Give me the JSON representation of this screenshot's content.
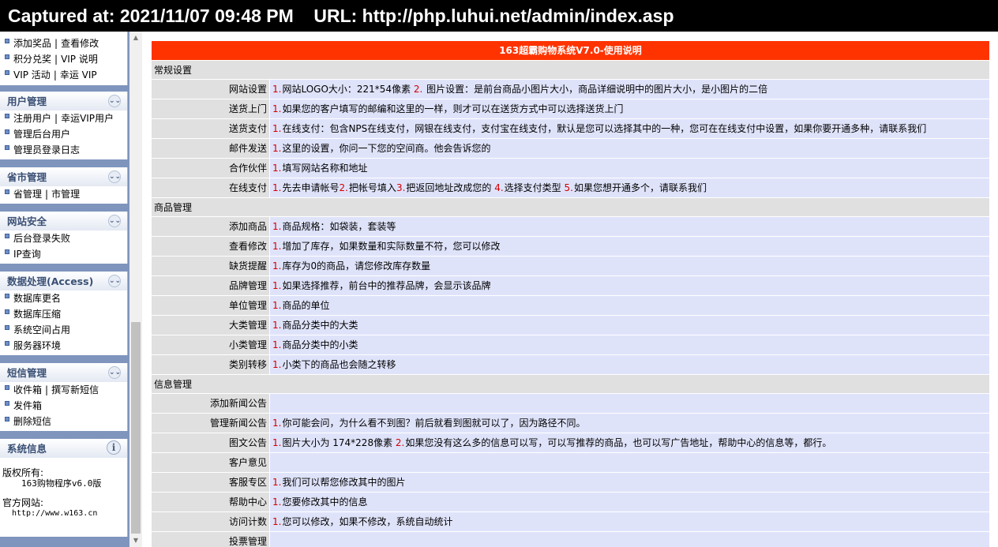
{
  "capture_bar": {
    "text": "Captured at: 2021/11/07 09:48 PM    URL: http://php.luhui.net/admin/index.asp"
  },
  "sidebar": {
    "top_partial": {
      "lines": [
        [
          "添加奖品",
          "查看修改"
        ],
        [
          "积分兑奖",
          "VIP 说明"
        ],
        [
          "VIP 活动",
          "幸运 VIP"
        ]
      ]
    },
    "user_mgmt": {
      "title": "用户管理",
      "lines": [
        [
          "注册用户",
          "幸运VIP用户"
        ],
        [
          "管理后台用户"
        ],
        [
          "管理员登录日志"
        ]
      ]
    },
    "region_mgmt": {
      "title": "省市管理",
      "lines": [
        [
          "省管理",
          "市管理"
        ]
      ]
    },
    "site_security": {
      "title": "网站安全",
      "lines": [
        [
          "后台登录失败"
        ],
        [
          "IP查询"
        ]
      ]
    },
    "data_proc": {
      "title": "数据处理(Access)",
      "lines": [
        [
          "数据库更名"
        ],
        [
          "数据库压缩"
        ],
        [
          "系统空间占用"
        ],
        [
          "服务器环境"
        ]
      ]
    },
    "sms_mgmt": {
      "title": "短信管理",
      "lines": [
        [
          "收件箱",
          "撰写新短信"
        ],
        [
          "发件箱"
        ],
        [
          "删除短信"
        ]
      ]
    },
    "sys_info": {
      "title": "系统信息",
      "copyright_label": "版权所有:",
      "copyright_value": "163购物程序v6.0版",
      "site_label": "官方网站:",
      "site_value": "http://www.w163.cn"
    },
    "collapse_icon": "double-chevron-down-icon",
    "info_icon": "info-icon"
  },
  "main": {
    "title": "163超霸购物系统V7.0-使用说明",
    "title_bg": "#ff3300",
    "sections": [
      {
        "name": "常规设置",
        "rows": [
          {
            "label": "网站设置",
            "parts": [
              {
                "n": "1.",
                "t": "网站LOGO大小：221*54像素 "
              },
              {
                "n": "2.",
                "t": " 图片设置：是前台商品小图片大小，商品详细说明中的图片大小，是小图片的二倍"
              }
            ]
          },
          {
            "label": "送货上门",
            "parts": [
              {
                "n": "1.",
                "t": "如果您的客户填写的邮编和这里的一样，则才可以在送货方式中可以选择送货上门"
              }
            ]
          },
          {
            "label": "送货支付",
            "parts": [
              {
                "n": "1.",
                "t": "在线支付：包含NPS在线支付，网银在线支付，支付宝在线支付，默认是您可以选择其中的一种，您可在在线支付中设置，如果你要开通多种，请联系我们"
              }
            ]
          },
          {
            "label": "邮件发送",
            "parts": [
              {
                "n": "1.",
                "t": "这里的设置，你问一下您的空间商。他会告诉您的"
              }
            ]
          },
          {
            "label": "合作伙伴",
            "parts": [
              {
                "n": "1.",
                "t": "填写网站名称和地址"
              }
            ]
          },
          {
            "label": "在线支付",
            "parts": [
              {
                "n": "1.",
                "t": "先去申请帐号"
              },
              {
                "n": "2.",
                "t": "把帐号填入"
              },
              {
                "n": "3.",
                "t": "把返回地址改成您的 "
              },
              {
                "n": "4.",
                "t": "选择支付类型 "
              },
              {
                "n": "5.",
                "t": "如果您想开通多个，请联系我们"
              }
            ]
          }
        ]
      },
      {
        "name": "商品管理",
        "rows": [
          {
            "label": "添加商品",
            "parts": [
              {
                "n": "1.",
                "t": "商品规格：如袋装，套装等"
              }
            ]
          },
          {
            "label": "查看修改",
            "parts": [
              {
                "n": "1.",
                "t": "增加了库存，如果数量和实际数量不符，您可以修改"
              }
            ]
          },
          {
            "label": "缺货提醒",
            "parts": [
              {
                "n": "1.",
                "t": "库存为0的商品，请您修改库存数量"
              }
            ]
          },
          {
            "label": "品牌管理",
            "parts": [
              {
                "n": "1.",
                "t": "如果选择推荐，前台中的推荐品牌，会显示该品牌"
              }
            ]
          },
          {
            "label": "单位管理",
            "parts": [
              {
                "n": "1.",
                "t": "商品的单位"
              }
            ]
          },
          {
            "label": "大类管理",
            "parts": [
              {
                "n": "1.",
                "t": "商品分类中的大类"
              }
            ]
          },
          {
            "label": "小类管理",
            "parts": [
              {
                "n": "1.",
                "t": "商品分类中的小类"
              }
            ]
          },
          {
            "label": "类别转移",
            "parts": [
              {
                "n": "1.",
                "t": "小类下的商品也会随之转移"
              }
            ]
          }
        ]
      },
      {
        "name": "信息管理",
        "rows": [
          {
            "label": "添加新闻公告",
            "parts": []
          },
          {
            "label": "管理新闻公告",
            "parts": [
              {
                "n": "1.",
                "t": "你可能会问，为什么看不到图？前后就看到图就可以了，因为路径不同。"
              }
            ]
          },
          {
            "label": "图文公告",
            "parts": [
              {
                "n": "1.",
                "t": "图片大小为 174*228像素 "
              },
              {
                "n": "2.",
                "t": "如果您没有这么多的信息可以写，可以写推荐的商品，也可以写广告地址，帮助中心的信息等，都行。"
              }
            ]
          },
          {
            "label": "客户意见",
            "parts": []
          },
          {
            "label": "客服专区",
            "parts": [
              {
                "n": "1.",
                "t": "我们可以帮您修改其中的图片"
              }
            ]
          },
          {
            "label": "帮助中心",
            "parts": [
              {
                "n": "1.",
                "t": "您要修改其中的信息"
              }
            ]
          },
          {
            "label": "访问计数",
            "parts": [
              {
                "n": "1.",
                "t": "您可以修改，如果不修改，系统自动统计"
              }
            ]
          },
          {
            "label": "投票管理",
            "parts": []
          }
        ]
      }
    ]
  }
}
